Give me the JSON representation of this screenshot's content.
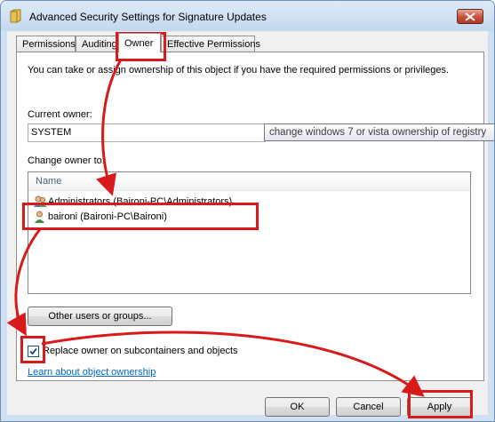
{
  "window": {
    "title": "Advanced Security Settings for Signature Updates"
  },
  "tabs": [
    {
      "label": "Permissions"
    },
    {
      "label": "Auditing"
    },
    {
      "label": "Owner"
    },
    {
      "label": "Effective Permissions"
    }
  ],
  "owner_tab": {
    "description": "You can take or assign ownership of this object if you have the required permissions or privileges.",
    "current_owner_label": "Current owner:",
    "current_owner_value": "SYSTEM",
    "change_owner_label": "Change owner to:",
    "list_header": "Name",
    "owners": [
      {
        "label": "Administrators (Baironi-PC\\Administrators)",
        "icon": "user-group-icon"
      },
      {
        "label": "baironi (Baironi-PC\\Baironi)",
        "icon": "user-icon"
      }
    ],
    "other_users_button": "Other users or groups...",
    "replace_owner_label": "Replace owner on subcontainers and objects",
    "replace_owner_checked": true,
    "learn_link": "Learn about object ownership"
  },
  "tooltip": "change windows 7 or vista ownership of registry",
  "buttons": {
    "ok": "OK",
    "cancel": "Cancel",
    "apply": "Apply"
  },
  "colors": {
    "annotation_red": "#d91a1a",
    "link_blue": "#0066cc",
    "titlebar": "#c3d7ee"
  }
}
